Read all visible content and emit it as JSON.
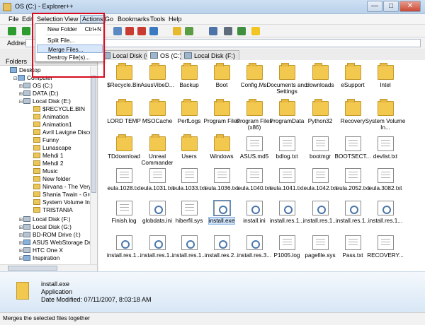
{
  "window": {
    "title": "OS (C:) - Explorer++",
    "minimize": "—",
    "maximize": "□",
    "close": "✕"
  },
  "menu": {
    "file": "File",
    "edit": "Edit",
    "selection": "Selection",
    "view": "View",
    "actions": "Actions",
    "go": "Go",
    "bookmarks": "Bookmarks",
    "tools": "Tools",
    "help": "Help"
  },
  "address": {
    "label": "Address"
  },
  "tabs": [
    {
      "label": "Local Disk (G:)"
    },
    {
      "label": "OS (C:)"
    },
    {
      "label": "Local Disk (F:)"
    }
  ],
  "actions_menu": {
    "new_folder": "New Folder",
    "new_folder_shortcut": "Ctrl+N",
    "split": "Split File...",
    "merge": "Merge Files...",
    "destroy": "Destroy File(s)..."
  },
  "tree": {
    "header": "Folders",
    "items": [
      {
        "label": "Desktop"
      },
      {
        "label": "Computer"
      },
      {
        "label": "OS (C:)"
      },
      {
        "label": "DATA (D:)"
      },
      {
        "label": "Local Disk (E:)"
      },
      {
        "label": "$RECYCLE.BIN"
      },
      {
        "label": "Animation"
      },
      {
        "label": "Animation1"
      },
      {
        "label": "Avril Lavigne Disco"
      },
      {
        "label": "Funny"
      },
      {
        "label": "Lunascape"
      },
      {
        "label": "Mehdi 1"
      },
      {
        "label": "Mehdi 2"
      },
      {
        "label": "Music"
      },
      {
        "label": "New folder"
      },
      {
        "label": "Nirvana - The Very"
      },
      {
        "label": "Shania Twain - Gre"
      },
      {
        "label": "System Volume Info"
      },
      {
        "label": "TRISTANIA"
      },
      {
        "label": "Local Disk (F:)"
      },
      {
        "label": "Local Disk (G:)"
      },
      {
        "label": "BD-ROM Drive (I:)"
      },
      {
        "label": "ASUS WebStorage Driv"
      },
      {
        "label": "HTC One X"
      },
      {
        "label": "Inspiration"
      }
    ]
  },
  "files": [
    {
      "name": "$Recycle.Bin"
    },
    {
      "name": "AsusVibeD..."
    },
    {
      "name": "Backup"
    },
    {
      "name": "Boot"
    },
    {
      "name": "Config.Msi"
    },
    {
      "name": "Documents and Settings"
    },
    {
      "name": "downloads"
    },
    {
      "name": "eSupport"
    },
    {
      "name": "Intel"
    },
    {
      "name": "LORD TEMP"
    },
    {
      "name": "MSOCache"
    },
    {
      "name": "PerfLogs"
    },
    {
      "name": "Program Files"
    },
    {
      "name": "Program Files (x86)"
    },
    {
      "name": "ProgramData"
    },
    {
      "name": "Python32"
    },
    {
      "name": "Recovery"
    },
    {
      "name": "System Volume In..."
    },
    {
      "name": "TDdownload"
    },
    {
      "name": "Unreal Commander"
    },
    {
      "name": "Users"
    },
    {
      "name": "Windows"
    },
    {
      "name": "ASUS.md5"
    },
    {
      "name": "bdlog.txt"
    },
    {
      "name": "bootmgr"
    },
    {
      "name": "BOOTSECT..."
    },
    {
      "name": "devlist.txt"
    },
    {
      "name": "eula.1028.txt"
    },
    {
      "name": "eula.1031.txt"
    },
    {
      "name": "eula.1033.txt"
    },
    {
      "name": "eula.1036.txt"
    },
    {
      "name": "eula.1040.txt"
    },
    {
      "name": "eula.1041.txt"
    },
    {
      "name": "eula.1042.txt"
    },
    {
      "name": "eula.2052.txt"
    },
    {
      "name": "eula.3082.txt"
    },
    {
      "name": "Finish.log"
    },
    {
      "name": "globdata.ini"
    },
    {
      "name": "hiberfil.sys"
    },
    {
      "name": "install.exe"
    },
    {
      "name": "install.ini"
    },
    {
      "name": "install.res.1..."
    },
    {
      "name": "install.res.1..."
    },
    {
      "name": "install.res.1..."
    },
    {
      "name": "install.res.1..."
    },
    {
      "name": "install.res.1..."
    },
    {
      "name": "install.res.1..."
    },
    {
      "name": "install.res.1..."
    },
    {
      "name": "install.res.2..."
    },
    {
      "name": "install.res.3..."
    },
    {
      "name": "P1005.log"
    },
    {
      "name": "pagefile.sys"
    },
    {
      "name": "Pass.txt"
    },
    {
      "name": "RECOVERY..."
    }
  ],
  "details": {
    "name": "install.exe",
    "type": "Application",
    "date": "Date Modified: 07/11/2007, 8:03:18 AM"
  },
  "status": "Merges the selected files together",
  "colors": {
    "highlight": "#d7e6f9",
    "annotation_red": "#d90c1f"
  }
}
